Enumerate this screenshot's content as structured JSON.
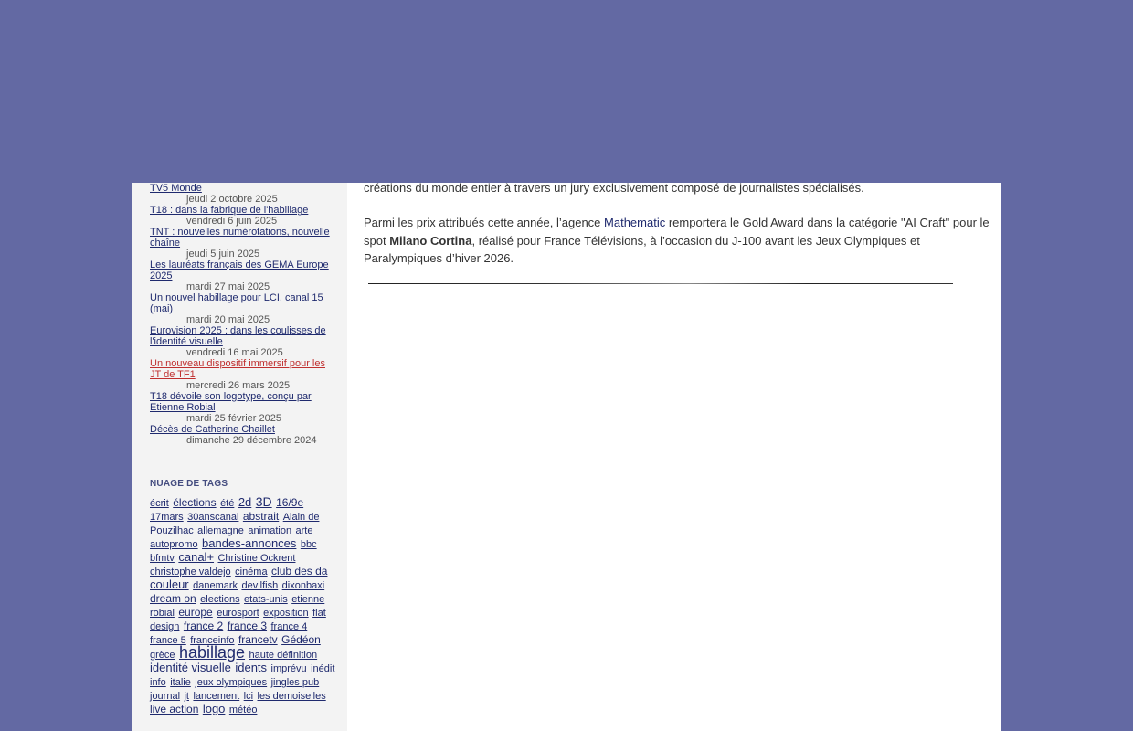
{
  "articles": [
    {
      "title": "TV5 Monde",
      "date": "jeudi 2 octobre 2025"
    },
    {
      "title": "T18 : dans la fabrique de l'habillage",
      "date": "vendredi 6 juin 2025"
    },
    {
      "title": "TNT : nouvelles numérotations, nouvelle chaîne",
      "date": "jeudi 5 juin 2025"
    },
    {
      "title": "Les lauréats français des GEMA Europe 2025",
      "date": "mardi 27 mai 2025"
    },
    {
      "title": "Un nouvel habillage pour LCI, canal 15 (mai)",
      "date": "mardi 20 mai 2025"
    },
    {
      "title": "Eurovision 2025 : dans les coulisses de l'identité visuelle",
      "date": "vendredi 16 mai 2025"
    },
    {
      "title": "Un nouveau dispositif immersif pour les JT de TF1",
      "date": "mercredi 26 mars 2025",
      "active": true
    },
    {
      "title": "T18 dévoile son logotype, conçu par Etienne Robial",
      "date": "mardi 25 février 2025"
    },
    {
      "title": "Décès de Catherine Chaillet",
      "date": "dimanche 29 décembre 2024"
    }
  ],
  "tags": {
    "title": "NUAGE DE TAGS",
    "items": [
      {
        "label": "écrit",
        "size": 11
      },
      {
        "label": "élections",
        "size": 12
      },
      {
        "label": "été",
        "size": 11
      },
      {
        "label": "2d",
        "size": 13
      },
      {
        "label": "3D",
        "size": 14
      },
      {
        "label": "16/9e",
        "size": 12
      },
      {
        "label": "17mars",
        "size": 11
      },
      {
        "label": "30anscanal",
        "size": 11
      },
      {
        "label": "abstrait",
        "size": 12
      },
      {
        "label": "Alain de Pouzilhac",
        "size": 11
      },
      {
        "label": "allemagne",
        "size": 11
      },
      {
        "label": "animation",
        "size": 11
      },
      {
        "label": "arte",
        "size": 11
      },
      {
        "label": "autopromo",
        "size": 11
      },
      {
        "label": "bandes-annonces",
        "size": 13
      },
      {
        "label": "bbc",
        "size": 11
      },
      {
        "label": "bfmtv",
        "size": 11
      },
      {
        "label": "canal+",
        "size": 13
      },
      {
        "label": "Christine Ockrent",
        "size": 11
      },
      {
        "label": "christophe valdejo",
        "size": 11
      },
      {
        "label": "cinéma",
        "size": 11
      },
      {
        "label": "club des da",
        "size": 12
      },
      {
        "label": "couleur",
        "size": 13
      },
      {
        "label": "danemark",
        "size": 11
      },
      {
        "label": "devilfish",
        "size": 11
      },
      {
        "label": "dixonbaxi",
        "size": 11
      },
      {
        "label": "dream on",
        "size": 12
      },
      {
        "label": "elections",
        "size": 11
      },
      {
        "label": "etats-unis",
        "size": 11
      },
      {
        "label": "etienne robial",
        "size": 11
      },
      {
        "label": "europe",
        "size": 12
      },
      {
        "label": "eurosport",
        "size": 11
      },
      {
        "label": "exposition",
        "size": 11
      },
      {
        "label": "flat design",
        "size": 11
      },
      {
        "label": "france 2",
        "size": 12
      },
      {
        "label": "france 3",
        "size": 12
      },
      {
        "label": "france 4",
        "size": 11
      },
      {
        "label": "france 5",
        "size": 11
      },
      {
        "label": "franceinfo",
        "size": 11
      },
      {
        "label": "francetv",
        "size": 12
      },
      {
        "label": "Gédéon",
        "size": 12
      },
      {
        "label": "grèce",
        "size": 11
      },
      {
        "label": "habillage",
        "size": 18
      },
      {
        "label": "haute définition",
        "size": 11
      },
      {
        "label": "identité visuelle",
        "size": 13
      },
      {
        "label": "idents",
        "size": 13
      },
      {
        "label": "imprévu",
        "size": 11
      },
      {
        "label": "inédit",
        "size": 11
      },
      {
        "label": "info",
        "size": 11
      },
      {
        "label": "italie",
        "size": 11
      },
      {
        "label": "jeux olympiques",
        "size": 11
      },
      {
        "label": "jingles pub",
        "size": 11
      },
      {
        "label": "journal",
        "size": 11
      },
      {
        "label": "jt",
        "size": 11
      },
      {
        "label": "lancement",
        "size": 11
      },
      {
        "label": "lci",
        "size": 11
      },
      {
        "label": "les demoiselles",
        "size": 11
      },
      {
        "label": "live action",
        "size": 12
      },
      {
        "label": "logo",
        "size": 13
      },
      {
        "label": "météo",
        "size": 11
      }
    ]
  },
  "main": {
    "p1": "créations du monde entier à travers un jury exclusivement composé de journalistes spécialisés.",
    "p2_before": "Parmi les prix attribués cette année, l’agence ",
    "p2_link": "Mathematic",
    "p2_middle": " remportera le Gold Award dans la catégorie \"AI Craft\" pour le spot ",
    "p2_bold": "Milano Cortina",
    "p2_after": ", réalisé pour France Télévisions, à l’occasion du J-100 avant les Jeux Olympiques et Paralympiques d’hiver 2026."
  },
  "colors": {
    "background": "#6369a3",
    "link": "#1f2a6e",
    "active_link": "#c03030",
    "sidebar": "#f3f3f3"
  }
}
